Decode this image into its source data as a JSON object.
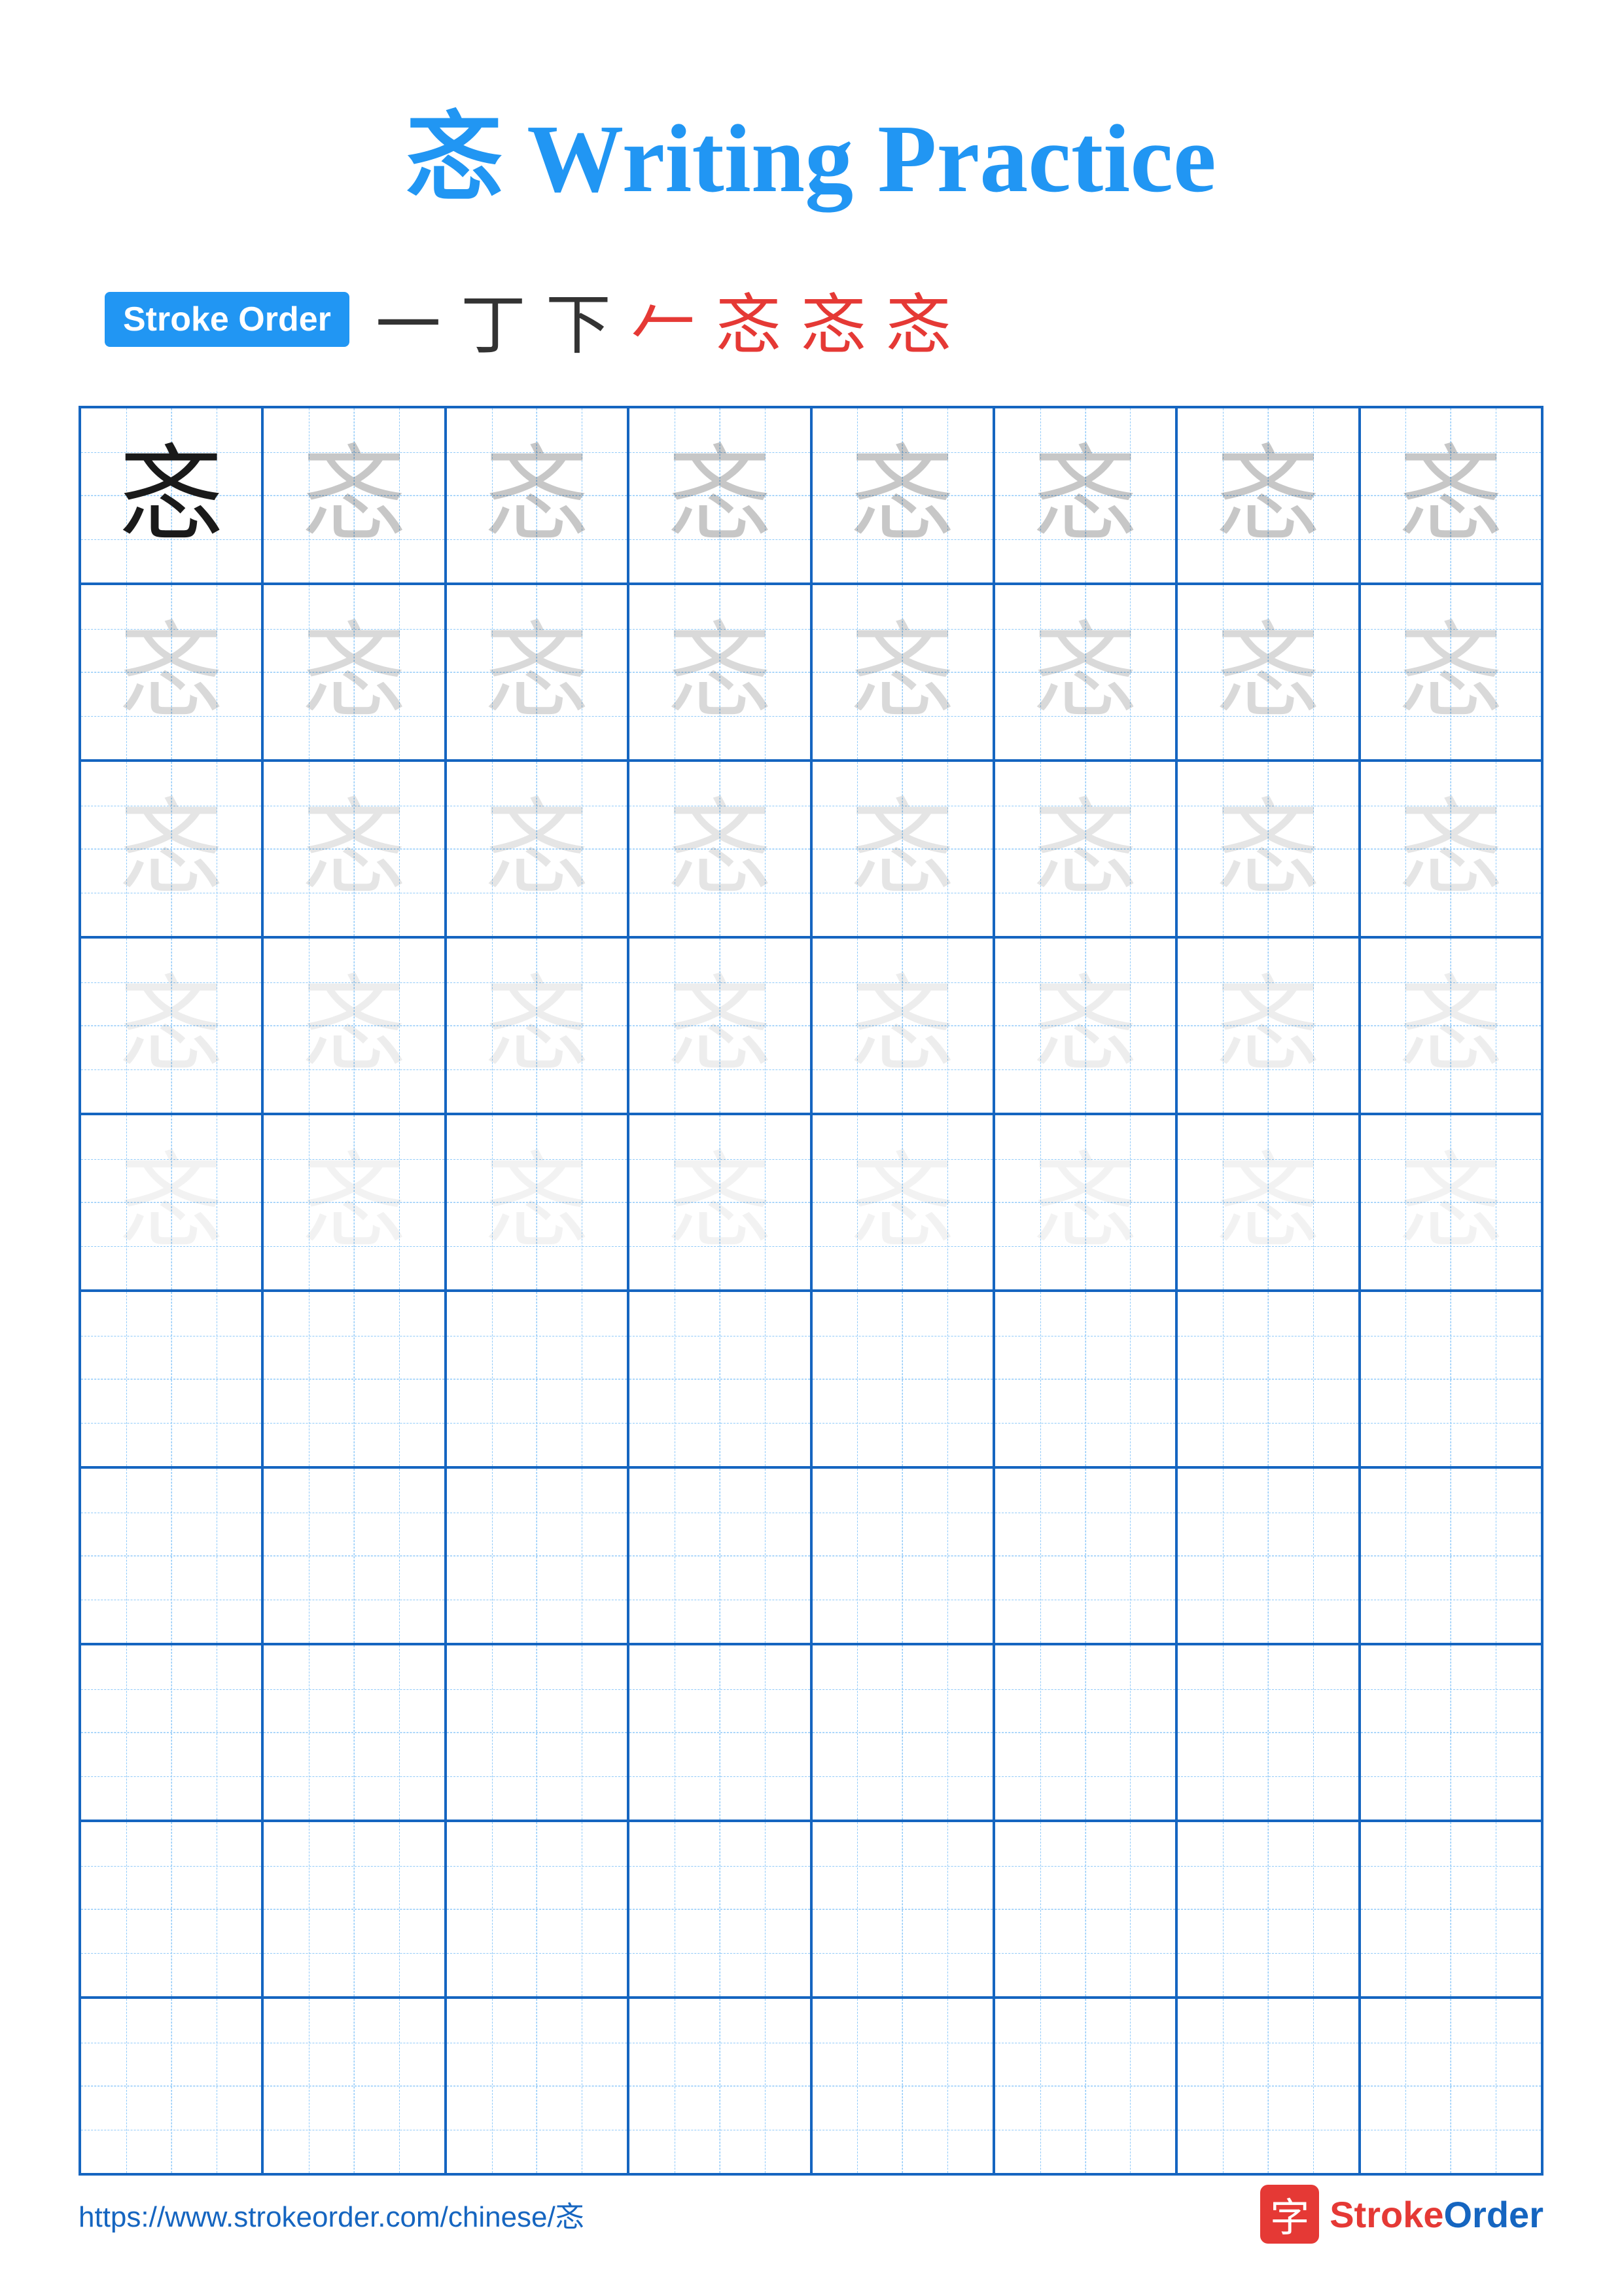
{
  "title": {
    "character": "忞",
    "text": "Writing Practice",
    "full": "忞 Writing Practice"
  },
  "stroke_order": {
    "badge_label": "Stroke Order",
    "strokes": [
      "一",
      "丁",
      "下",
      "𠂉",
      "忞",
      "忞",
      "忞"
    ]
  },
  "grid": {
    "rows": 10,
    "cols": 8,
    "character": "忞",
    "filled_rows": 5
  },
  "footer": {
    "url": "https://www.strokeorder.com/chinese/忞",
    "logo_text": "StrokeOrder"
  },
  "colors": {
    "primary_blue": "#2196F3",
    "dark_blue": "#1565C0",
    "red": "#e53935",
    "grid_border": "#1565C0",
    "grid_guide": "#90CAF9"
  }
}
